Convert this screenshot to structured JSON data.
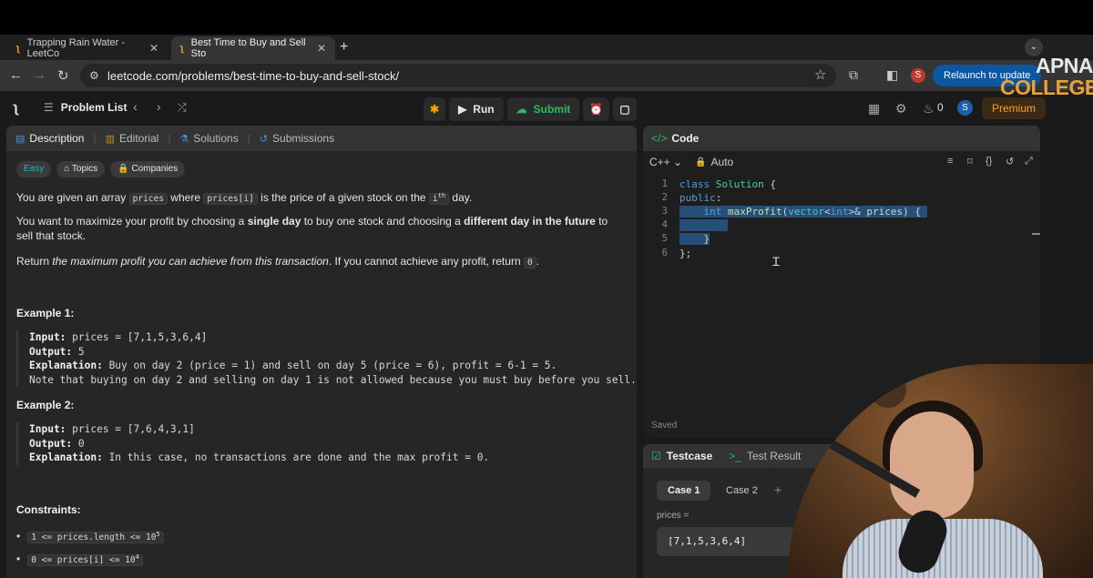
{
  "browser": {
    "tabs": [
      {
        "title": "Trapping Rain Water - LeetCo",
        "active": false
      },
      {
        "title": "Best Time to Buy and Sell Sto",
        "active": true
      }
    ],
    "url": "leetcode.com/problems/best-time-to-buy-and-sell-stock/",
    "profile_initial": "S",
    "relaunch_label": "Relaunch to update"
  },
  "watermark": {
    "line1": "APNA",
    "line2": "COLLEGE"
  },
  "nav": {
    "problem_list": "Problem List",
    "run": "Run",
    "submit": "Submit",
    "streak": "0",
    "avatar_initial": "S",
    "premium": "Premium"
  },
  "desc_tabs": [
    {
      "label": "Description",
      "icon": "document-icon",
      "active": true
    },
    {
      "label": "Editorial",
      "icon": "book-icon"
    },
    {
      "label": "Solutions",
      "icon": "flask-icon"
    },
    {
      "label": "Submissions",
      "icon": "history-icon"
    }
  ],
  "tags": [
    "Easy",
    "Topics",
    "Companies"
  ],
  "problem": {
    "p1": {
      "a": "You are given an array ",
      "code1": "prices",
      "b": " where ",
      "code2": "prices[i]",
      "c": " is the price of a given stock on the ",
      "code3": "i",
      "sup": "th",
      "d": " day."
    },
    "p2": {
      "a": "You want to maximize your profit by choosing a ",
      "b1": "single day",
      "b": " to buy one stock and choosing a ",
      "b2": "different day in the future",
      "c": " to sell that stock."
    },
    "p3": {
      "a": "Return ",
      "i": "the maximum profit you can achieve from this transaction",
      "b": ". If you cannot achieve any profit, return ",
      "code": "0",
      "c": "."
    },
    "example1": {
      "title": "Example 1:",
      "input_label": "Input:",
      "input": " prices = [7,1,5,3,6,4]",
      "output_label": "Output:",
      "output": " 5",
      "explanation_label": "Explanation:",
      "explanation": " Buy on day 2 (price = 1) and sell on day 5 (price = 6), profit = 6-1 = 5.",
      "note": "Note that buying on day 2 and selling on day 1 is not allowed because you must buy before you sell."
    },
    "example2": {
      "title": "Example 2:",
      "input_label": "Input:",
      "input": " prices = [7,6,4,3,1]",
      "output_label": "Output:",
      "output": " 0",
      "explanation_label": "Explanation:",
      "explanation": " In this case, no transactions are done and the max profit = 0."
    },
    "constraints_title": "Constraints:",
    "constraints": [
      {
        "code": "1 <= prices.length <= 10",
        "sup": "5"
      },
      {
        "code": "0 <= prices[i] <= 10",
        "sup": "4"
      }
    ]
  },
  "code": {
    "header": "Code",
    "language": "C++",
    "mode": "Auto",
    "line_numbers": [
      "1",
      "2",
      "3",
      "4",
      "5",
      "6"
    ],
    "status": "Saved"
  },
  "testcase": {
    "tab1": "Testcase",
    "tab2": "Test Result",
    "cases": [
      "Case 1",
      "Case 2"
    ],
    "param_label": "prices =",
    "param_value": "[7,1,5,3,6,4]"
  }
}
